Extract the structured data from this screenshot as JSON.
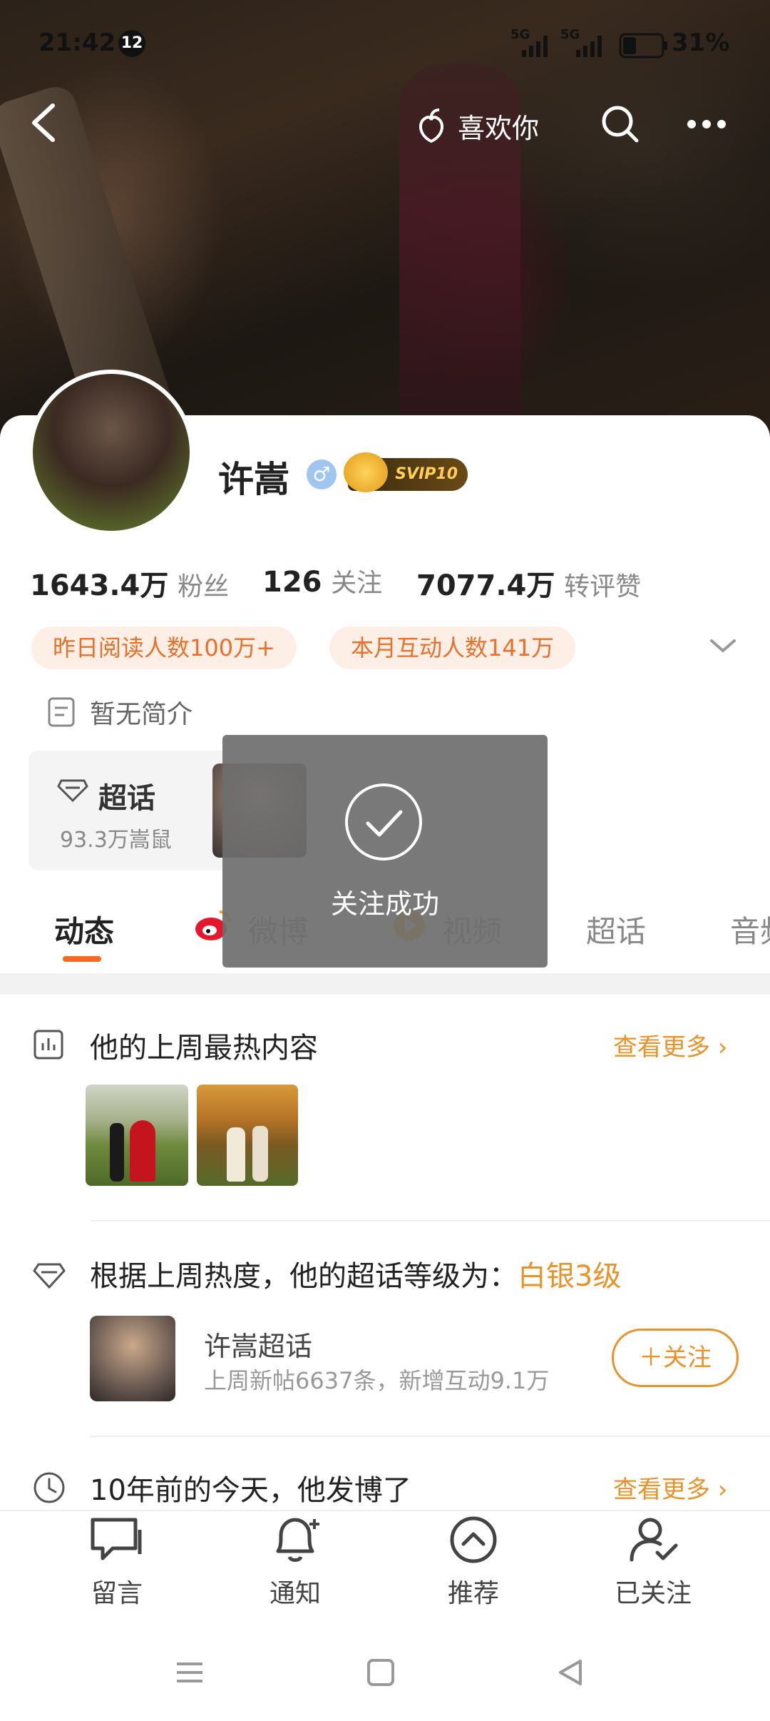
{
  "status": {
    "time": "21:42",
    "notif_count": "12",
    "signal1": "5G",
    "signal2": "5G",
    "battery": "31%"
  },
  "nav": {
    "like_label": "喜欢你"
  },
  "profile": {
    "name": "许嵩",
    "vip_badge": "SVIP10"
  },
  "stats": [
    {
      "value": "1643.4万",
      "label": "粉丝"
    },
    {
      "value": "126",
      "label": "关注"
    },
    {
      "value": "7077.4万",
      "label": "转评赞"
    }
  ],
  "pills": [
    "昨日阅读人数100万+",
    "本月互动人数141万"
  ],
  "intro": "暂无简介",
  "super": {
    "title": "超话",
    "sub": "93.3万嵩鼠"
  },
  "toast": {
    "text": "关注成功"
  },
  "tabs": [
    "动态",
    "微博",
    "视频",
    "超话",
    "音频"
  ],
  "hot": {
    "title": "他的上周最热内容",
    "more": "查看更多"
  },
  "level": {
    "prefix": "根据上周热度，他的超话等级为：",
    "level": "白银3级",
    "topic_name": "许嵩超话",
    "topic_stats": "上周新帖6637条，新增互动9.1万",
    "follow": "＋关注"
  },
  "history": {
    "title": "10年前的今天，他发博了",
    "more": "查看更多"
  },
  "bottom": [
    "留言",
    "通知",
    "推荐",
    "已关注"
  ],
  "colors": {
    "accent": "#e8932a",
    "pill_text": "#e8702a",
    "tab_active": "#f56a1e"
  }
}
